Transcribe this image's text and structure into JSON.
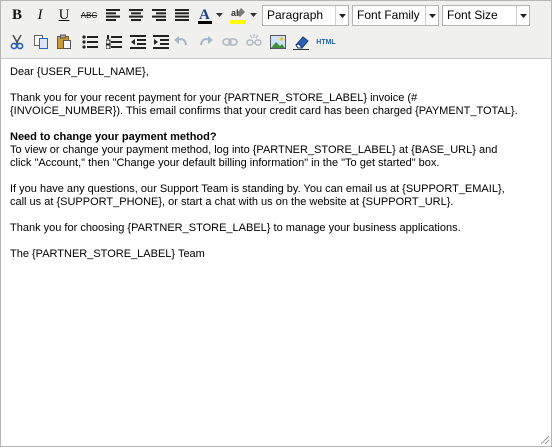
{
  "toolbar": {
    "bold_label": "B",
    "italic_label": "I",
    "underline_label": "U",
    "strike_label": "ABC",
    "html_label": "HTML",
    "format_select": {
      "value": "Paragraph"
    },
    "font_family_select": {
      "value": "Font Family"
    },
    "font_size_select": {
      "value": "Font Size"
    },
    "colors": {
      "text_color": "#000000",
      "highlight_color": "#ffff00",
      "link_blue": "#2a62b6"
    }
  },
  "editor_content": {
    "greeting": "Dear {USER_FULL_NAME},",
    "para1": "Thank you for your recent payment for your {PARTNER_STORE_LABEL} invoice (#\n{INVOICE_NUMBER}). This email confirms that your credit card has been charged {PAYMENT_TOTAL}.",
    "heading": "Need to change your payment method?",
    "para2": "To view or change your payment method, log into {PARTNER_STORE_LABEL} at {BASE_URL} and\nclick \"Account,\" then \"Change your default billing information\" in the \"To get started\" box.",
    "para3": "If you have any questions, our Support Team is standing by. You can email us at {SUPPORT_EMAIL},\ncall us at {SUPPORT_PHONE}, or start a chat with us on the website at {SUPPORT_URL}.",
    "para4": "Thank you for choosing {PARTNER_STORE_LABEL} to manage your business applications.",
    "signoff": "The {PARTNER_STORE_LABEL} Team"
  }
}
